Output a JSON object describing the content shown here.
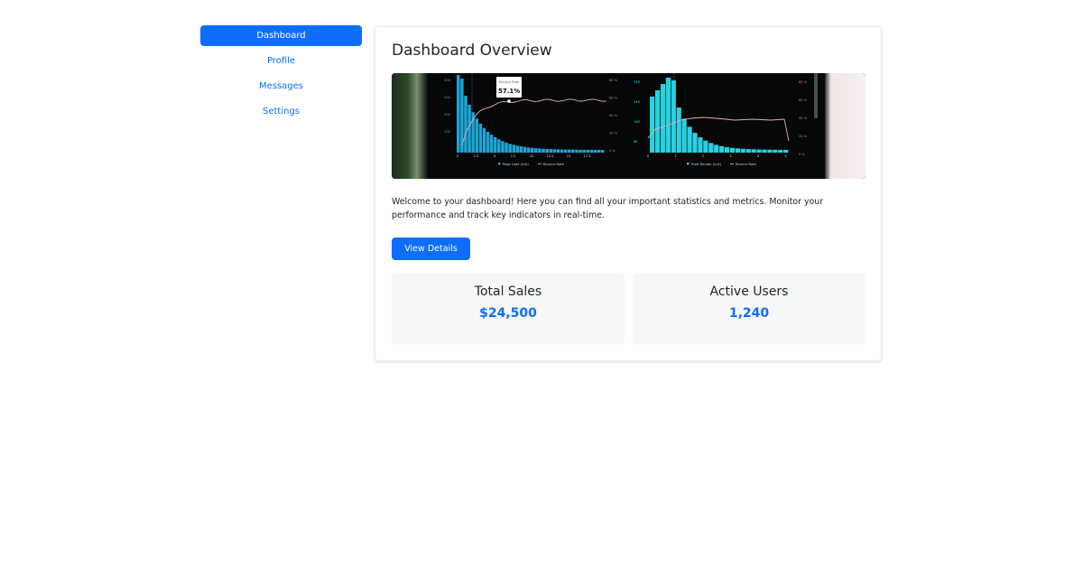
{
  "sidebar": {
    "items": [
      {
        "label": "Dashboard",
        "active": true
      },
      {
        "label": "Profile",
        "active": false
      },
      {
        "label": "Messages",
        "active": false
      },
      {
        "label": "Settings",
        "active": false
      }
    ]
  },
  "main": {
    "title": "Dashboard Overview",
    "intro": "Welcome to your dashboard! Here you can find all your important statistics and metrics. Monitor your performance and track key indicators in real-time.",
    "view_details_label": "View Details",
    "stats": [
      {
        "label": "Total Sales",
        "value": "$24,500"
      },
      {
        "label": "Active Users",
        "value": "1,240"
      }
    ]
  },
  "hero_image": {
    "description_icon": "analytics-screen-photo",
    "left_chart": {
      "y_ticks": [
        "30K",
        "25K",
        "20K",
        "15K"
      ],
      "y2_ticks": [
        "80 %",
        "60 %",
        "40 %",
        "20 %",
        "0 %"
      ],
      "x_ticks": [
        "0",
        "2.5",
        "5",
        "7.5",
        "10",
        "12.5",
        "15",
        "17.5"
      ],
      "tooltip_title": "Bounce Rate",
      "tooltip_value": "57.1%",
      "legend": [
        "Page Load (LLK)",
        "Bounce Rate"
      ]
    },
    "right_chart": {
      "y_ticks": [
        "32K",
        "24K",
        "16K",
        "8K"
      ],
      "y2_ticks": [
        "80 %",
        "60 %",
        "40 %",
        "20 %",
        "0 %"
      ],
      "x_ticks": [
        "0",
        "1",
        "2",
        "3",
        "4",
        "5"
      ],
      "legend": [
        "Start Render (LLK)",
        "Bounce Rate"
      ]
    }
  },
  "colors": {
    "primary": "#0d6efd",
    "bar_left": "#1aa6d6",
    "bar_right": "#27d2e0",
    "line": "#f0a8b8"
  }
}
